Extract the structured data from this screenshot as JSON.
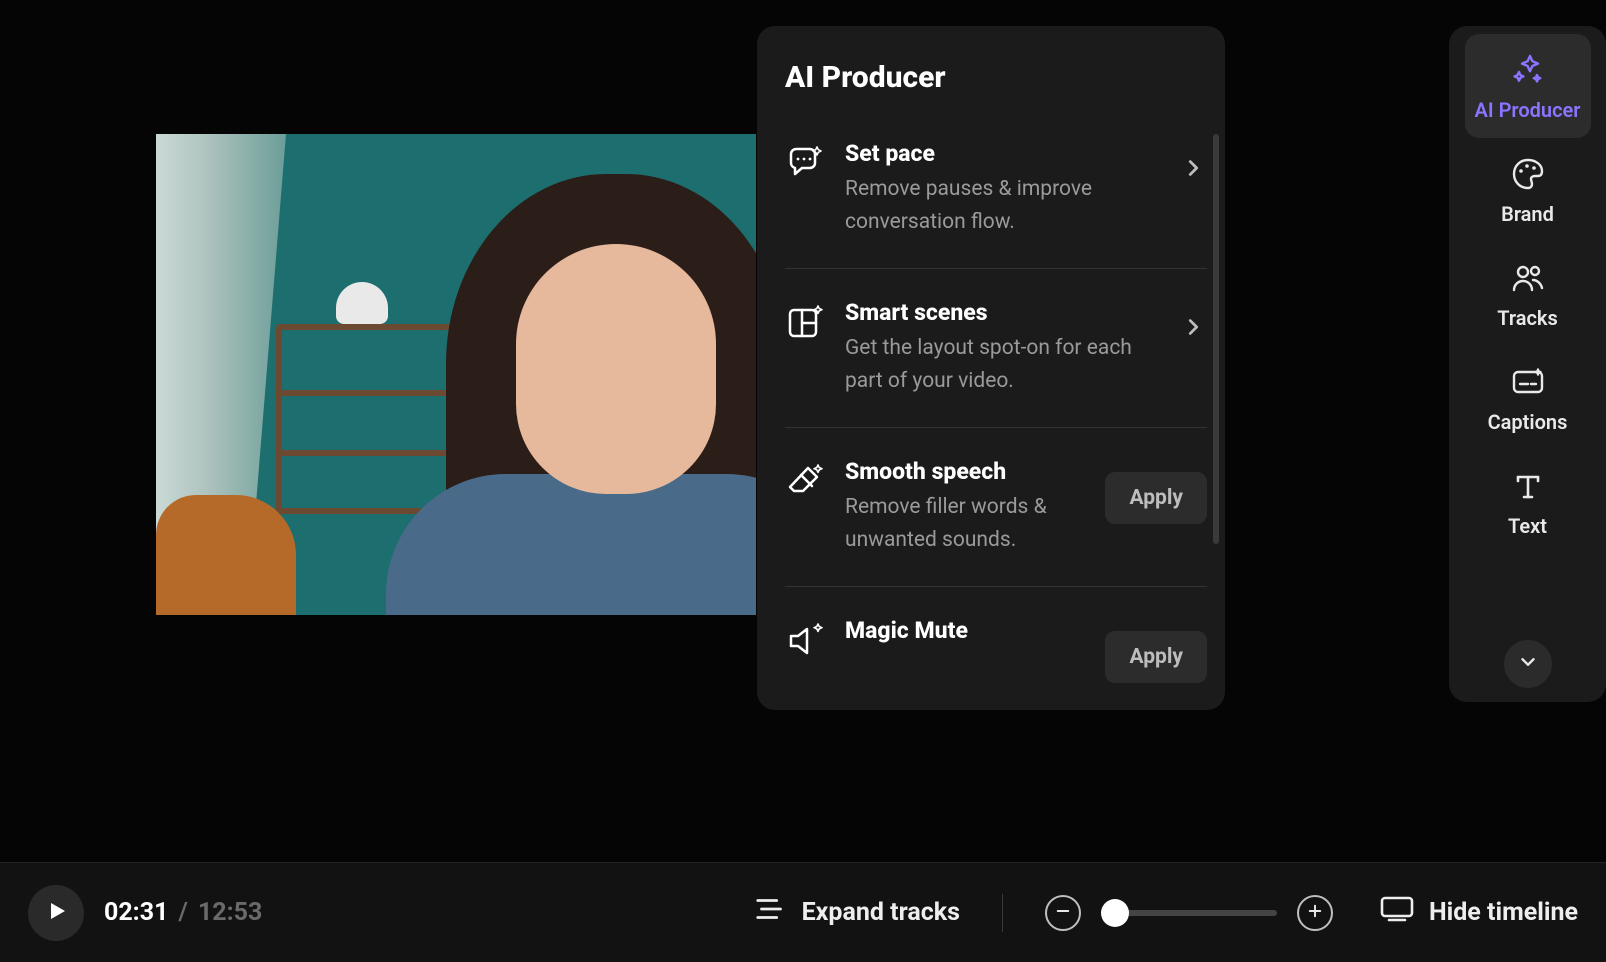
{
  "colors": {
    "accent": "#8b74ff",
    "panel_bg": "#1b1b1b",
    "bar_bg": "#121212",
    "muted_text": "#9a9a9a"
  },
  "panel": {
    "title": "AI Producer",
    "items": [
      {
        "icon": "chat-sparkle-icon",
        "title": "Set pace",
        "desc": "Remove pauses & improve conversation flow.",
        "action": "chevron"
      },
      {
        "icon": "layout-sparkle-icon",
        "title": "Smart scenes",
        "desc": "Get the layout spot-on for each part of your video.",
        "action": "chevron"
      },
      {
        "icon": "eraser-sparkle-icon",
        "title": "Smooth speech",
        "desc": "Remove filler words & unwanted sounds.",
        "action": "apply",
        "action_label": "Apply"
      },
      {
        "icon": "mute-sparkle-icon",
        "title": "Magic Mute",
        "desc": "",
        "action": "apply",
        "action_label": "Apply"
      }
    ]
  },
  "sidebar": {
    "items": [
      {
        "icon": "sparkles-icon",
        "label": "AI Producer",
        "active": true
      },
      {
        "icon": "palette-icon",
        "label": "Brand",
        "active": false
      },
      {
        "icon": "people-icon",
        "label": "Tracks",
        "active": false
      },
      {
        "icon": "captions-icon",
        "label": "Captions",
        "active": false
      },
      {
        "icon": "text-icon",
        "label": "Text",
        "active": false
      }
    ],
    "more_icon": "chevron-down-icon"
  },
  "transport": {
    "play_icon": "play-icon",
    "current_time": "02:31",
    "separator": "/",
    "total_time": "12:53",
    "expand_tracks_label": "Expand tracks",
    "expand_tracks_icon": "tracks-expand-icon",
    "zoom_out_icon": "zoom-out-icon",
    "zoom_in_icon": "zoom-in-icon",
    "zoom_position_percent": 8,
    "hide_timeline_label": "Hide timeline",
    "hide_timeline_icon": "monitor-icon"
  },
  "preview": {
    "description": "Woman with long dark hair in denim jacket smiling, teal room with shelf and lamp behind her"
  }
}
